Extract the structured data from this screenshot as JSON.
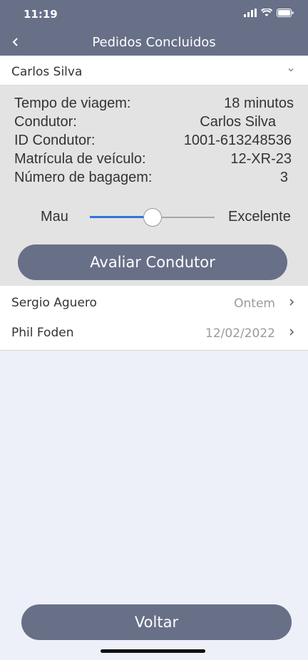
{
  "status_bar": {
    "time": "11:19"
  },
  "header": {
    "title": "Pedidos Concluidos"
  },
  "expanded_order": {
    "name": "Carlos Silva",
    "details": [
      {
        "label": "Tempo de viagem:",
        "value": "18 minutos"
      },
      {
        "label": "Condutor:",
        "value": "Carlos Silva"
      },
      {
        "label": "ID Condutor:",
        "value": "1001-613248536"
      },
      {
        "label": "Matrícula de veículo:",
        "value": "12-XR-23"
      },
      {
        "label": "Número de bagagem:",
        "value": "3"
      }
    ],
    "rating": {
      "min_label": "Mau",
      "max_label": "Excelente",
      "level": 0.5
    },
    "rate_button": "Avaliar Condutor"
  },
  "orders": [
    {
      "name": "Sergio Aguero",
      "date": "Ontem"
    },
    {
      "name": "Phil Foden",
      "date": "12/02/2022"
    }
  ],
  "footer": {
    "back_button": "Voltar"
  },
  "colors": {
    "accent": "#687088",
    "slider": "#2f74d8"
  }
}
